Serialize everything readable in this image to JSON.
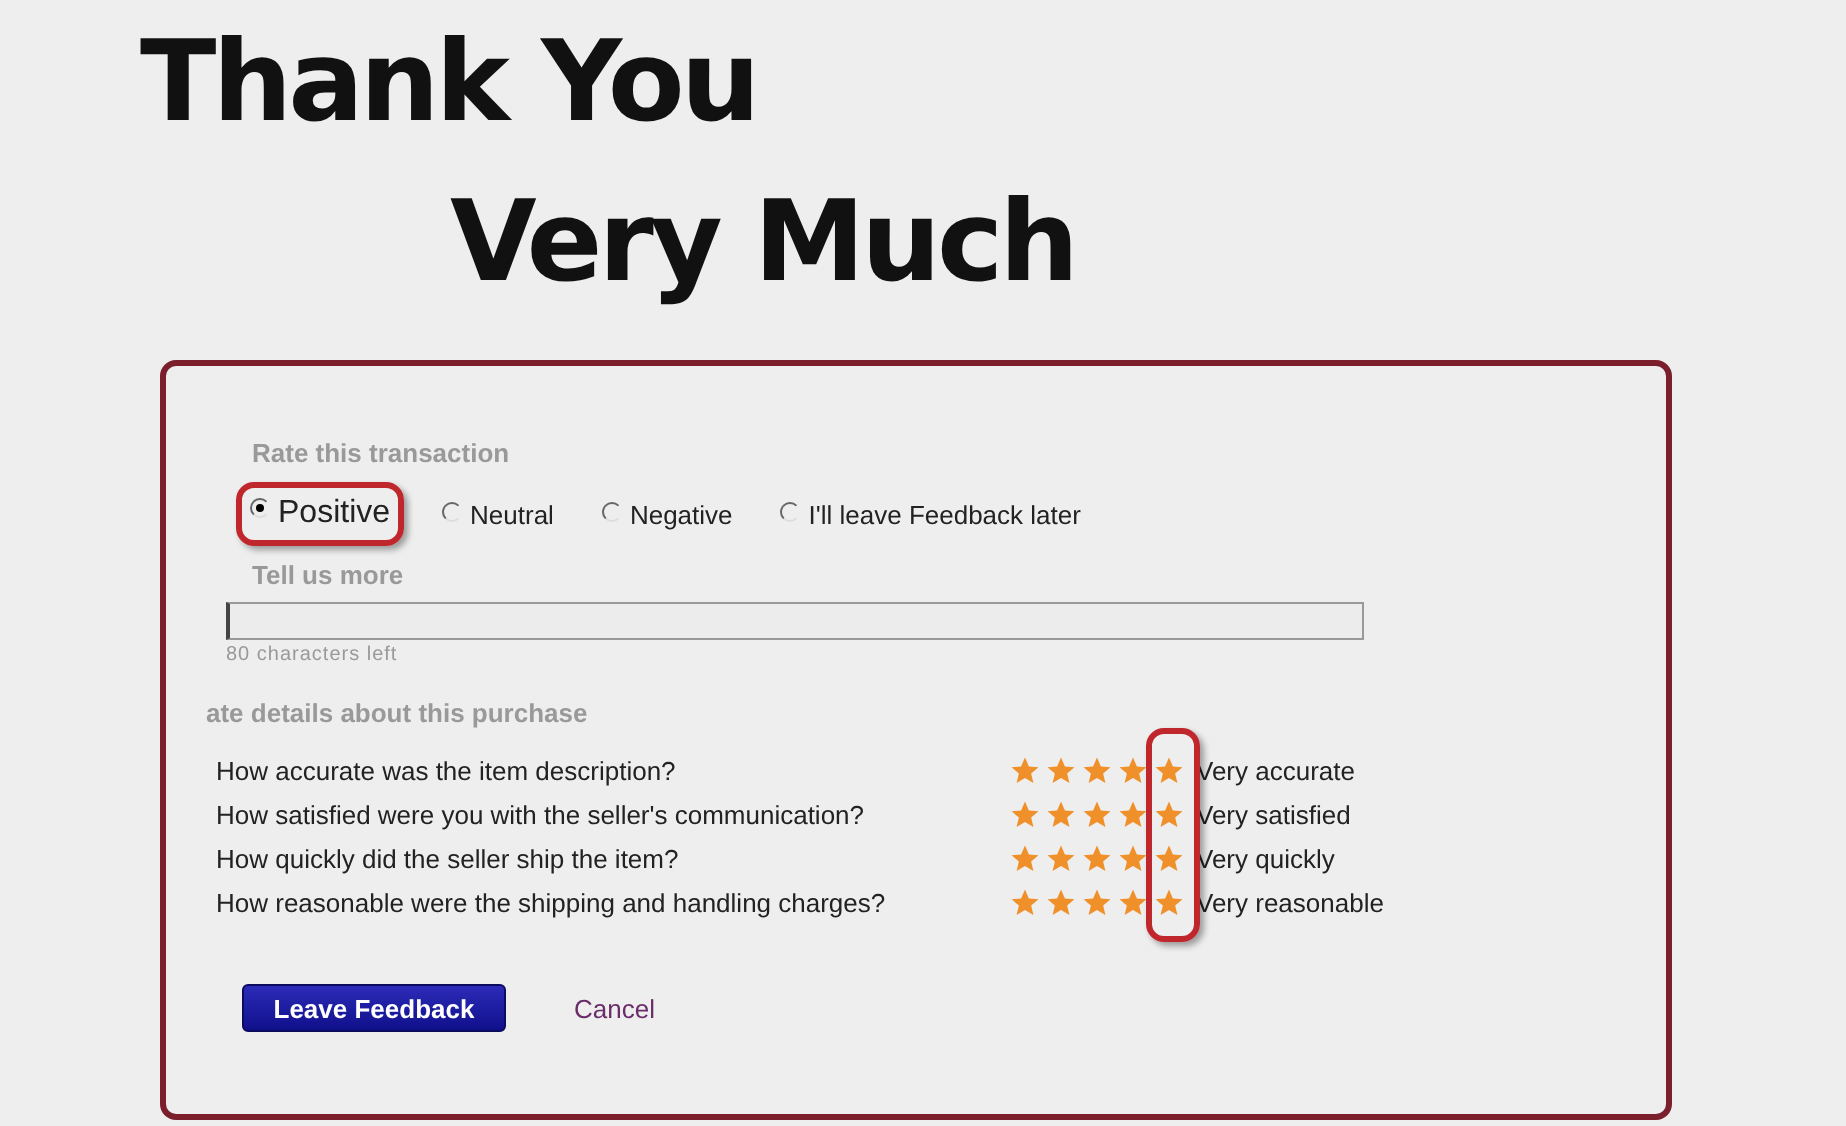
{
  "heading": {
    "line_1": "Thank You",
    "line_2": "Very Much"
  },
  "transaction": {
    "title": "Rate this transaction",
    "options": [
      {
        "label": "Positive",
        "selected": true,
        "highlighted": true
      },
      {
        "label": "Neutral",
        "selected": false,
        "highlighted": false
      },
      {
        "label": "Negative",
        "selected": false,
        "highlighted": false
      },
      {
        "label": "I'll leave Feedback later",
        "selected": false,
        "highlighted": false
      }
    ]
  },
  "comment": {
    "title": "Tell us more",
    "hint": "80 characters left"
  },
  "details": {
    "title": "ate details about this purchase",
    "rows": [
      {
        "question": "How accurate was the item description?",
        "stars": 5,
        "answer": "Very accurate"
      },
      {
        "question": "How satisfied were you with the seller's communication?",
        "stars": 5,
        "answer": "Very satisfied"
      },
      {
        "question": "How quickly did the seller ship the item?",
        "stars": 5,
        "answer": "Very quickly"
      },
      {
        "question": "How reasonable were the shipping and handling charges?",
        "stars": 5,
        "answer": "Very reasonable"
      }
    ]
  },
  "actions": {
    "submit": "Leave Feedback",
    "cancel": "Cancel"
  }
}
